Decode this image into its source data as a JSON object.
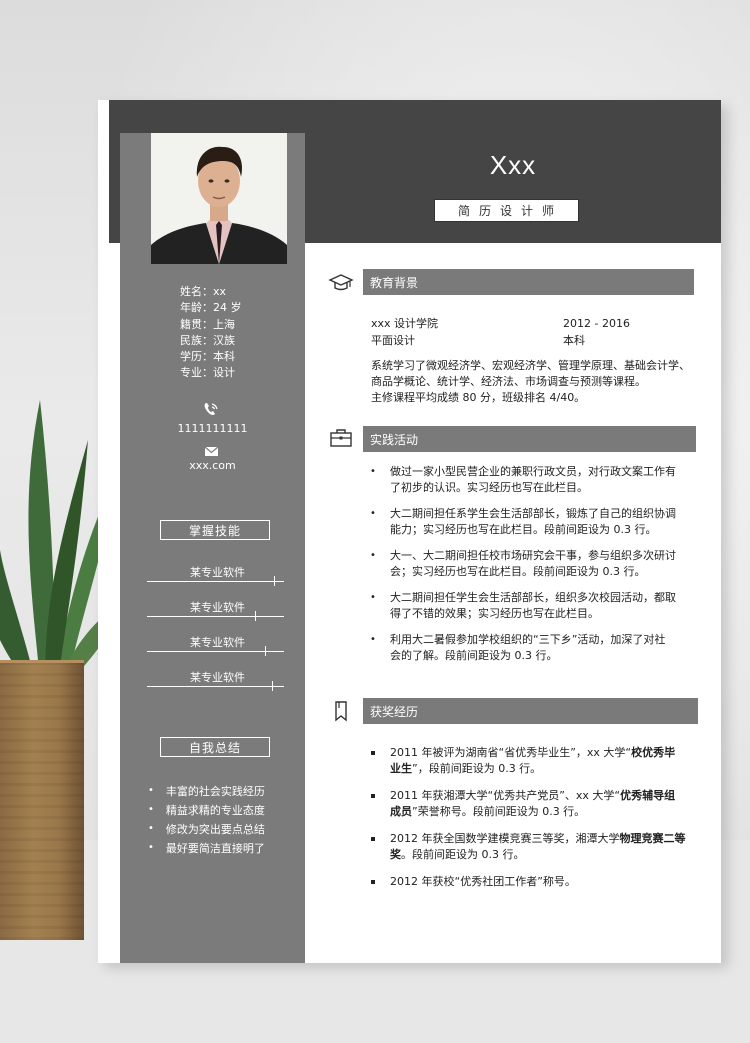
{
  "resume": {
    "name": "Xxx",
    "subtitle": "简历设计师"
  },
  "personal_info": [
    "姓名：xx",
    "年龄：24 岁",
    "籍贯：上海",
    "民族：汉族",
    "学历：本科",
    "专业：设计"
  ],
  "contact": {
    "phone": "1111111111",
    "email": "xxx.com",
    "phone_icon": "phone-icon",
    "email_icon": "envelope-icon"
  },
  "skills": {
    "heading": "掌握技能",
    "items": [
      {
        "label": "某专业软件",
        "level": 0.93
      },
      {
        "label": "某专业软件",
        "level": 0.79
      },
      {
        "label": "某专业软件",
        "level": 0.86
      },
      {
        "label": "某专业软件",
        "level": 0.91
      }
    ]
  },
  "self_summary": {
    "heading": "自我总结",
    "items": [
      "丰富的社会实践经历",
      "精益求精的专业态度",
      "修改为突出要点总结",
      "最好要简洁直接明了"
    ]
  },
  "education": {
    "heading": "教育背景",
    "icon": "graduation-cap-icon",
    "school": "xxx 设计学院",
    "period": "2012 - 2016",
    "major": "平面设计",
    "degree": "本科",
    "lines": [
      "系统学习了微观经济学、宏观经济学、管理学原理、基础会计学、",
      "商品学概论、统计学、经济法、市场调查与预测等课程。",
      "主修课程平均成绩 80 分，班级排名 4/40。"
    ]
  },
  "practice": {
    "heading": "实践活动",
    "icon": "briefcase-icon",
    "items": [
      [
        "做过一家小型民营企业的兼职行政文员，对行政文案工作有",
        "了初步的认识。实习经历也写在此栏目。"
      ],
      [
        "大二期间担任系学生会生活部部长，锻炼了自己的组织协调",
        "能力；实习经历也写在此栏目。段前间距设为 0.3 行。"
      ],
      [
        "大一、大二期间担任校市场研究会干事，参与组织多次研讨",
        "会；实习经历也写在此栏目。段前间距设为 0.3 行。"
      ],
      [
        "大二期间担任学生会生活部部长，组织多次校园活动，都取",
        "得了不错的效果；实习经历也写在此栏目。"
      ],
      [
        "利用大二暑假参加学校组织的“三下乡”活动，加深了对社",
        "会的了解。段前间距设为 0.3 行。"
      ]
    ]
  },
  "awards": {
    "heading": "获奖经历",
    "icon": "bookmark-icon",
    "items": [
      {
        "l1": "2011 年被评为湖南省“省优秀毕业生”，xx 大学“",
        "l1b": "校优秀毕",
        "l2b": "业生",
        "l2": "”，段前间距设为 0.3 行。"
      },
      {
        "l1": "2011 年获湘潭大学“优秀共产党员”、xx 大学“",
        "l1b": "优秀辅导组",
        "l2b": "成员",
        "l2": "”荣誉称号。段前间距设为 0.3 行。"
      },
      {
        "l1": "2012 年获全国数学建模竞赛三等奖，湘潭大学",
        "l1b": "物理竞赛二等",
        "l2b": "奖",
        "l2": "。段前间距设为 0.3 行。"
      },
      {
        "l1": "2012 年获校“优秀社团工作者”称号。",
        "l1b": "",
        "l2b": "",
        "l2": ""
      }
    ]
  }
}
